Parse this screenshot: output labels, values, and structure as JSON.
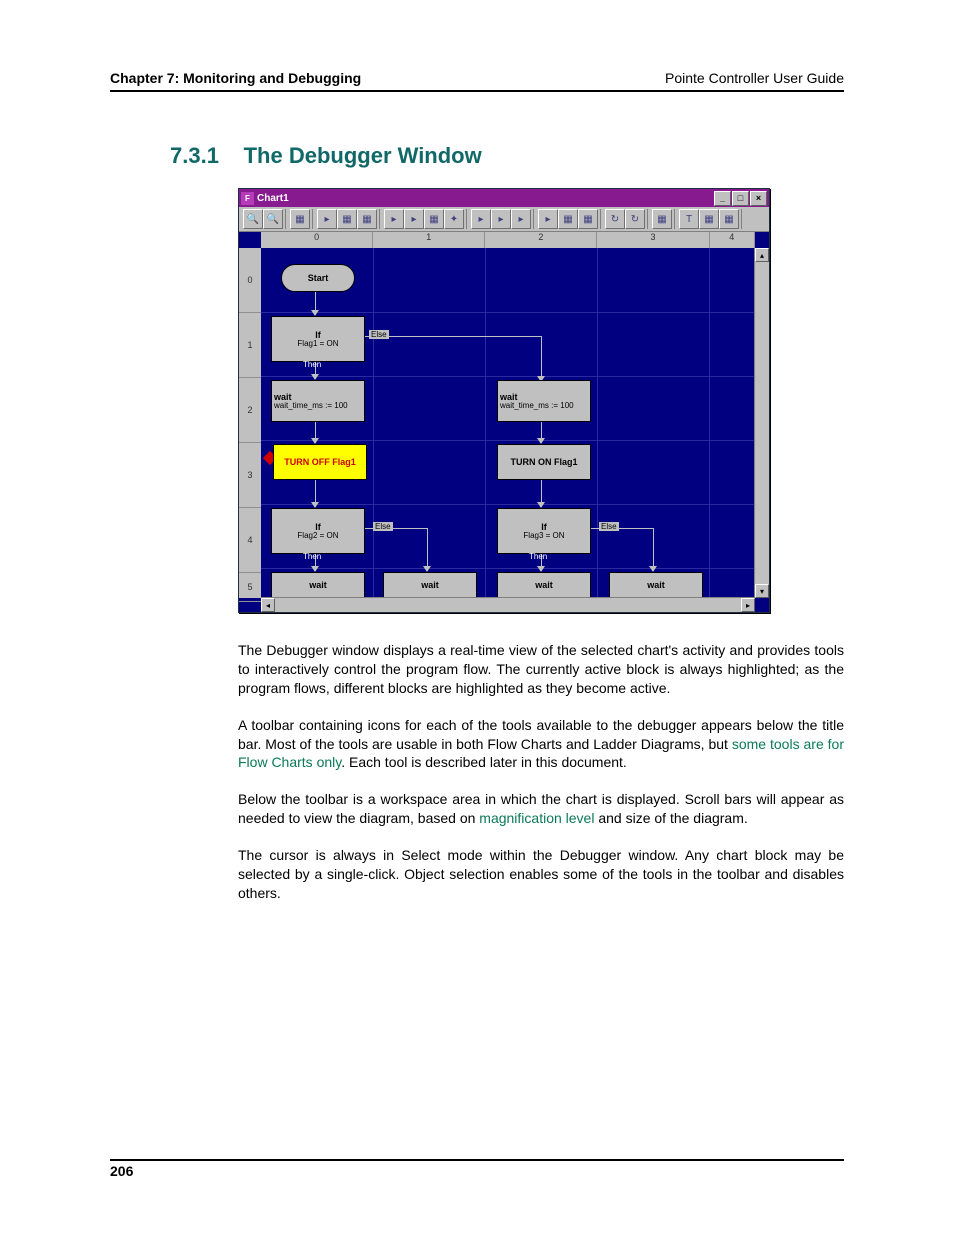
{
  "header": {
    "left": "Chapter 7: Monitoring and Debugging",
    "right": "Pointe Controller User Guide"
  },
  "section": {
    "number": "7.3.1",
    "title": "The Debugger Window"
  },
  "window": {
    "title": "Chart1",
    "columns": [
      "0",
      "1",
      "2",
      "3",
      "4"
    ],
    "rows": [
      "0",
      "1",
      "2",
      "3",
      "4",
      "5"
    ],
    "blocks": {
      "start": "Start",
      "if1_top": "If",
      "if1_cond": "Flag1 = ON",
      "wait_l": "wait",
      "wait_l_sub": "wait_time_ms := 100",
      "wait_r": "wait",
      "wait_r_sub": "wait_time_ms := 100",
      "off": "TURN OFF Flag1",
      "on": "TURN ON Flag1",
      "if2_top": "If",
      "if2_cond": "Flag2 = ON",
      "if3_top": "If",
      "if3_cond": "Flag3 = ON",
      "wait5a": "wait",
      "wait5b": "wait",
      "wait5c": "wait",
      "wait5d": "wait"
    },
    "labels": {
      "then": "Then",
      "else": "Else"
    }
  },
  "paragraphs": {
    "p1": "The Debugger window displays a real-time view of the selected chart's activity and provides tools to interactively control the program flow. The currently active block is always highlighted; as the program flows, different blocks are highlighted as they become active.",
    "p2a": "A toolbar containing icons for each of the tools available to the debugger appears below the title bar. Most of the tools are usable in both Flow Charts and Ladder Diagrams, but ",
    "p2link": "some tools are for Flow Charts only",
    "p2b": ". Each tool is described later in this document.",
    "p3a": "Below the toolbar is a workspace area in which the chart is displayed. Scroll bars will appear as needed to view the diagram, based on ",
    "p3link": "magnification level",
    "p3b": " and size of the diagram.",
    "p4": "The cursor is always in Select mode within the Debugger window. Any chart block may be selected by a single-click. Object selection enables some of the tools in the toolbar and disables others."
  },
  "footer": {
    "page": "206"
  }
}
